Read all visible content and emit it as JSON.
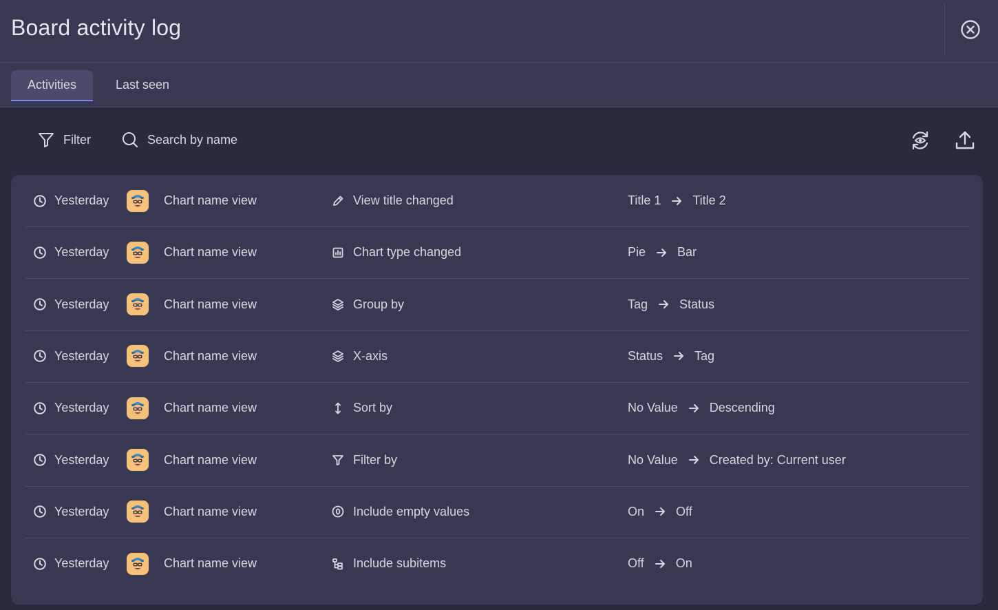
{
  "header": {
    "title": "Board activity log"
  },
  "tabs": [
    {
      "label": "Activities",
      "active": true
    },
    {
      "label": "Last seen",
      "active": false
    }
  ],
  "toolbar": {
    "filter_label": "Filter",
    "search_label": "Search by name"
  },
  "colors": {
    "accent": "#7b86f0",
    "avatar_bg": "#f6c27a"
  },
  "rows": [
    {
      "time": "Yesterday",
      "board": "Chart name view",
      "action_icon": "pencil-icon",
      "action": "View title changed",
      "from": "Title 1",
      "to": "Title 2"
    },
    {
      "time": "Yesterday",
      "board": "Chart name view",
      "action_icon": "chart-icon",
      "action": "Chart type changed",
      "from": "Pie",
      "to": "Bar"
    },
    {
      "time": "Yesterday",
      "board": "Chart name view",
      "action_icon": "layers-icon",
      "action": "Group by",
      "from": "Tag",
      "to": "Status"
    },
    {
      "time": "Yesterday",
      "board": "Chart name view",
      "action_icon": "layers-icon",
      "action": "X-axis",
      "from": "Status",
      "to": "Tag"
    },
    {
      "time": "Yesterday",
      "board": "Chart name view",
      "action_icon": "sort-icon",
      "action": "Sort by",
      "from": "No Value",
      "to": "Descending"
    },
    {
      "time": "Yesterday",
      "board": "Chart name view",
      "action_icon": "filter-icon",
      "action": "Filter by",
      "from": "No Value",
      "to": "Created by: Current user"
    },
    {
      "time": "Yesterday",
      "board": "Chart name view",
      "action_icon": "zero-circle-icon",
      "action": "Include empty values",
      "from": "On",
      "to": "Off"
    },
    {
      "time": "Yesterday",
      "board": "Chart name view",
      "action_icon": "subitems-icon",
      "action": "Include subitems",
      "from": "Off",
      "to": "On"
    }
  ]
}
